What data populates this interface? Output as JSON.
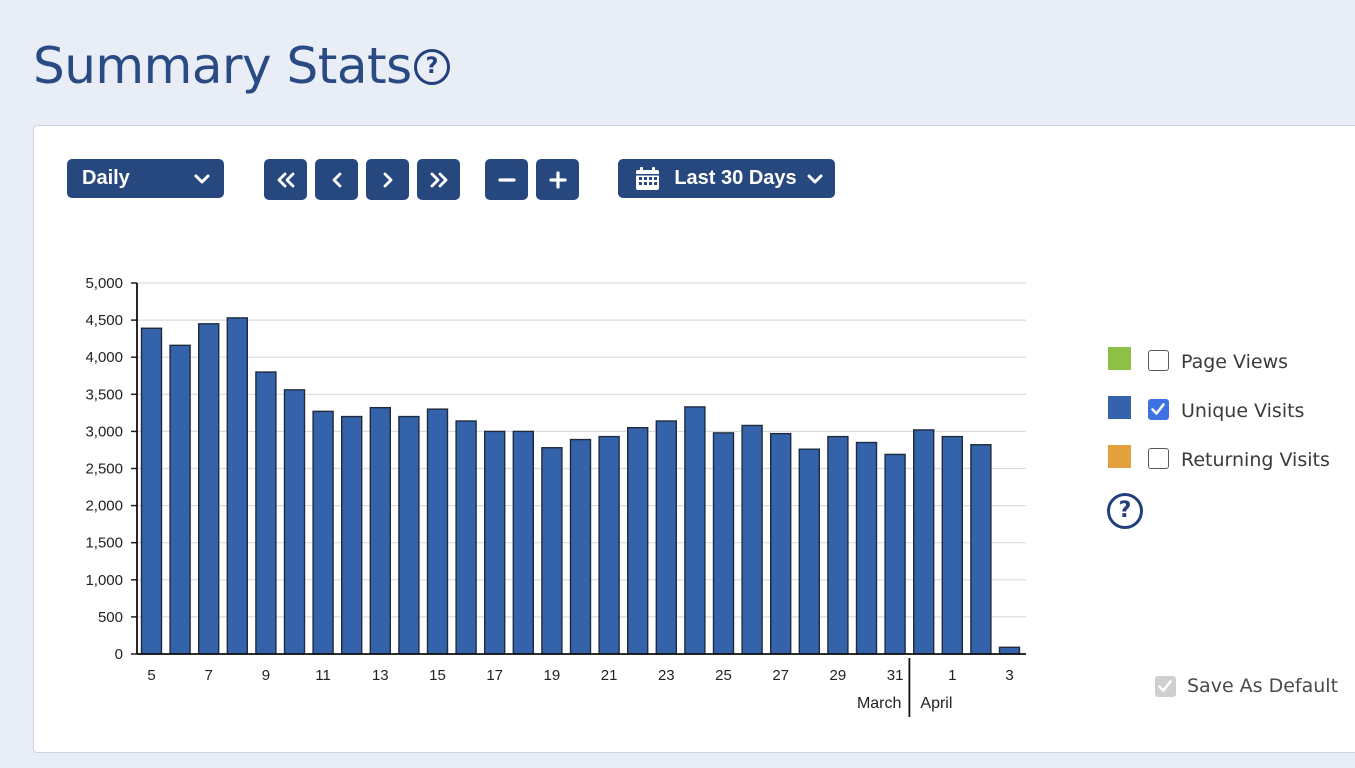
{
  "page": {
    "title": "Summary Stats",
    "help_symbol": "?"
  },
  "toolbar": {
    "period_select": {
      "selected": "Daily",
      "icon": "chevron-down-icon"
    },
    "first_icon": "double-chevron-left-icon",
    "prev_icon": "chevron-left-icon",
    "next_icon": "chevron-right-icon",
    "last_icon": "double-chevron-right-icon",
    "zoom_out_icon": "minus-icon",
    "zoom_in_icon": "plus-icon",
    "date_range": {
      "label": "Last 30 Days",
      "icon": "calendar-icon"
    }
  },
  "legend": {
    "items": [
      {
        "label": "Page Views",
        "color": "#8dc044",
        "checked": false
      },
      {
        "label": "Unique Visits",
        "color": "#3563ab",
        "checked": true
      },
      {
        "label": "Returning Visits",
        "color": "#e3a03c",
        "checked": false
      }
    ],
    "help_symbol": "?"
  },
  "save_default": {
    "label": "Save As Default",
    "checked": true,
    "disabled": true
  },
  "colors": {
    "accent": "#27477f",
    "bar": "#3563ab",
    "background": "#e9eef6"
  },
  "chart_data": {
    "type": "bar",
    "categories": [
      "5",
      "6",
      "7",
      "8",
      "9",
      "10",
      "11",
      "12",
      "13",
      "14",
      "15",
      "16",
      "17",
      "18",
      "19",
      "20",
      "21",
      "22",
      "23",
      "24",
      "25",
      "26",
      "27",
      "28",
      "29",
      "30",
      "31",
      "1",
      "2",
      "3",
      "4"
    ],
    "tick_labels": [
      "5",
      "7",
      "9",
      "11",
      "13",
      "15",
      "17",
      "19",
      "21",
      "23",
      "25",
      "27",
      "29",
      "31",
      "1",
      "3"
    ],
    "month_labels": [
      "March",
      "April"
    ],
    "series": [
      {
        "values": [
          4390,
          4160,
          4450,
          4530,
          3800,
          3560,
          3270,
          3200,
          3320,
          3200,
          3300,
          3140,
          3000,
          3000,
          2780,
          2890,
          2930,
          3050,
          3140,
          3330,
          2980,
          3080,
          2970,
          2760,
          2930,
          2850,
          2690,
          3020,
          2930,
          2820,
          90
        ],
        "color": "#3563ab"
      }
    ],
    "ylim": [
      0,
      5000
    ],
    "yticks": [
      "0",
      "500",
      "1,000",
      "1,500",
      "2,000",
      "2,500",
      "3,000",
      "3,500",
      "4,000",
      "4,500",
      "5,000"
    ],
    "grid": true,
    "legend_position": "right"
  }
}
